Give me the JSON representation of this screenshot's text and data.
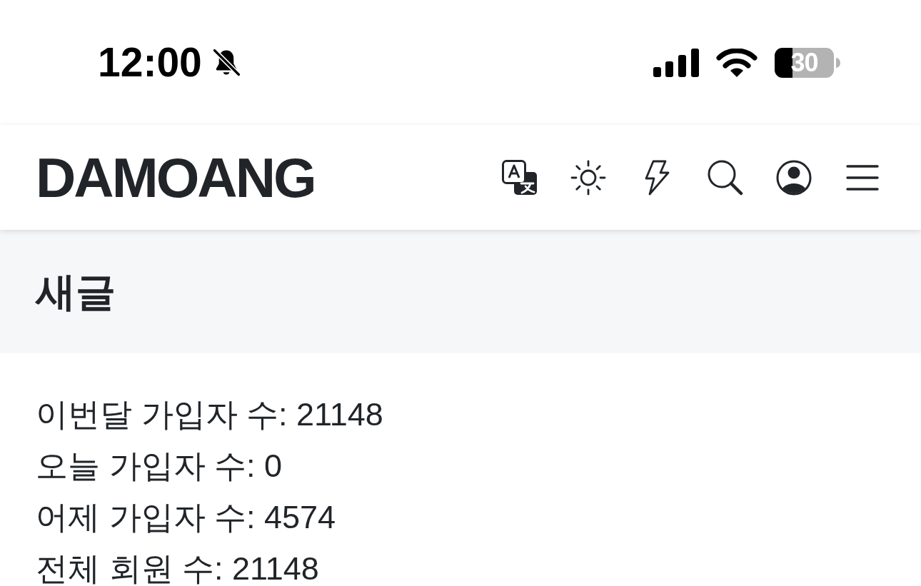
{
  "status_bar": {
    "time": "12:00",
    "silent": true,
    "battery": "30"
  },
  "header": {
    "logo": "DAMOANG"
  },
  "section": {
    "title": "새글"
  },
  "stats": [
    "이번달 가입자 수: 21148",
    "오늘 가입자 수: 0",
    "어제 가입자 수: 4574",
    "전체 회원 수: 21148"
  ]
}
